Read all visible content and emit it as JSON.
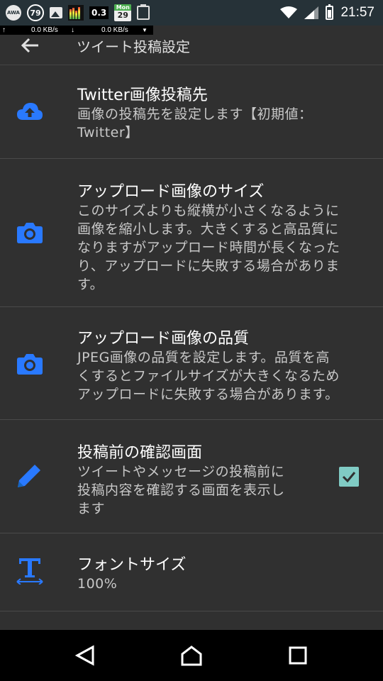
{
  "status_bar": {
    "awa_label": "AWA",
    "badge_number": "79",
    "meter_value": "0.3",
    "calendar_month": "Mon",
    "calendar_day": "29",
    "time": "21:57"
  },
  "net_speed": {
    "up": "0.0 KB/s",
    "down": "0.0 KB/s"
  },
  "app_bar": {
    "title": "ツイート投稿設定"
  },
  "settings": [
    {
      "icon": "cloud-upload-icon",
      "title": "Twitter画像投稿先",
      "desc_lines": [
        "画像の投稿先を設定します【初期値：",
        "Twitter】"
      ]
    },
    {
      "icon": "camera-icon",
      "title": "アップロード画像のサイズ",
      "desc_lines": [
        "このサイズよりも縦横が小さくなるように",
        "画像を縮小します。大きくすると高品質に",
        "なりますがアップロード時間が長くなった",
        "り、アップロードに失敗する場合がありま",
        "す。"
      ]
    },
    {
      "icon": "camera-icon",
      "title": "アップロード画像の品質",
      "desc_lines": [
        "JPEG画像の品質を設定します。品質を高",
        "くするとファイルサイズが大きくなるため",
        "アップロードに失敗する場合があります。"
      ]
    },
    {
      "icon": "pencil-icon",
      "title": "投稿前の確認画面",
      "desc_lines": [
        "ツイートやメッセージの投稿前に",
        "投稿内容を確認する画面を表示し",
        "ます"
      ],
      "checked": true
    },
    {
      "icon": "text-size-icon",
      "title": "フォントサイズ",
      "desc_lines": [
        "100%"
      ]
    }
  ],
  "colors": {
    "accent_blue": "#2979ff",
    "checkbox_teal": "#80cbc4",
    "background": "#303030"
  }
}
